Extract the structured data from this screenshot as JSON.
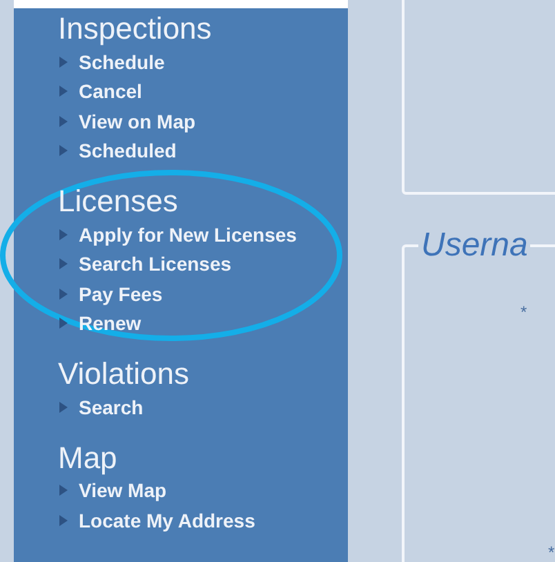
{
  "sidebar": {
    "sections": [
      {
        "title": "Inspections",
        "items": [
          "Schedule",
          "Cancel",
          "View on Map",
          "Scheduled"
        ]
      },
      {
        "title": "Licenses",
        "items": [
          "Apply for New Licenses",
          "Search Licenses",
          "Pay Fees",
          "Renew"
        ]
      },
      {
        "title": "Violations",
        "items": [
          "Search"
        ]
      },
      {
        "title": "Map",
        "items": [
          "View Map",
          "Locate My Address"
        ]
      }
    ]
  },
  "content": {
    "fieldsets": [
      {
        "kind": "panel"
      },
      {
        "kind": "panel",
        "legend": "Userna",
        "marks": [
          "*",
          "*"
        ]
      }
    ]
  },
  "annotation": {
    "kind": "ellipse"
  }
}
